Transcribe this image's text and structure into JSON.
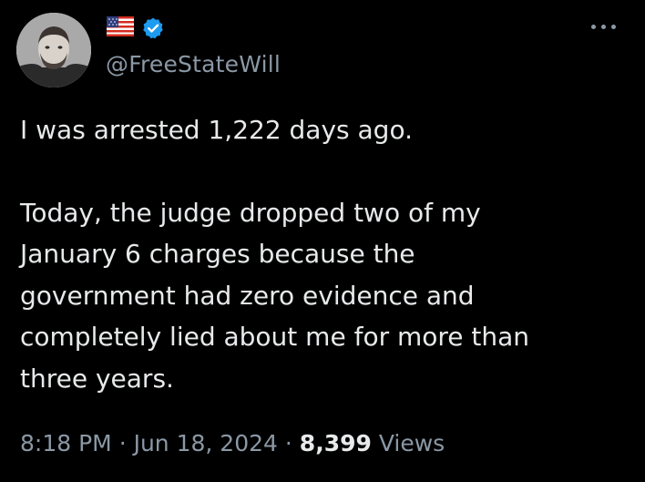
{
  "author": {
    "handle": "@FreeStateWill",
    "flag_icon": "us-flag-icon",
    "verified_icon": "verified-badge-icon",
    "verified_color": "#1d9bf0"
  },
  "menu": {
    "more_icon": "more-options-icon"
  },
  "tweet": {
    "line1": "I was arrested 1,222 days ago.",
    "line2": "Today, the judge dropped two of my",
    "line3": "January 6 charges because the",
    "line4": "government had zero evidence and",
    "line5": "completely lied about me for more than",
    "line6": "three years."
  },
  "meta": {
    "time": "8:18 PM",
    "separator": "·",
    "date": "Jun 18, 2024",
    "views_count": "8,399",
    "views_label": "Views"
  },
  "colors": {
    "background": "#000000",
    "text": "#e7e9ea",
    "secondary": "#8b98a5"
  }
}
